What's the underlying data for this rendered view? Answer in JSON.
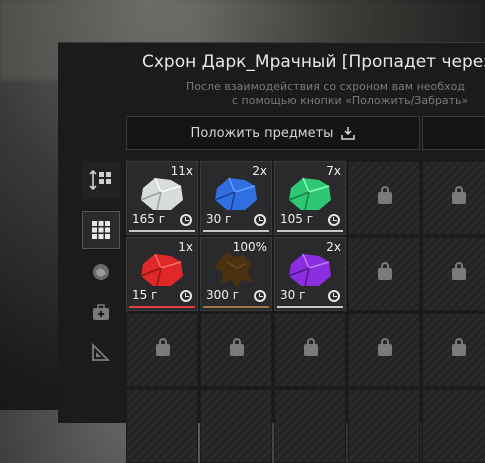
{
  "stash": {
    "title": "Схрон Дарк_Мрачный [Пропадет через",
    "hint_line1": "После взаимодействия со схроном вам необход",
    "hint_line2": "с помощью кнопки «Положить/Забрать»",
    "put_button": "Положить предметы"
  },
  "colors": {
    "accent_red": "#e04040",
    "item_bg": "#2a2a2c"
  },
  "sidebar": [
    {
      "name": "sort-button",
      "icon": "sort-icon"
    },
    {
      "name": "category-all",
      "icon": "grid-icon"
    },
    {
      "name": "category-ores",
      "icon": "ore-icon"
    },
    {
      "name": "category-medical",
      "icon": "medkit-icon"
    },
    {
      "name": "category-tools",
      "icon": "ruler-triangle-icon"
    }
  ],
  "items": [
    {
      "qty": "11x",
      "weight": "165 г",
      "color": "#d8dcdc",
      "rarity": "#c8c8c8"
    },
    {
      "qty": "2x",
      "weight": "30 г",
      "color": "#2f6fe0",
      "rarity": "#c8c8c8"
    },
    {
      "qty": "7x",
      "weight": "105 г",
      "color": "#2ec872",
      "rarity": "#c8c8c8"
    },
    {
      "qty": "1x",
      "weight": "15 г",
      "color": "#e02828",
      "rarity": "#e04040"
    },
    {
      "qty": "100%",
      "weight": "300 г",
      "color": "#4a3210",
      "rarity": "#9a7a4a"
    },
    {
      "qty": "2x",
      "weight": "30 г",
      "color": "#8a2ee0",
      "rarity": "#c8c8c8"
    }
  ]
}
